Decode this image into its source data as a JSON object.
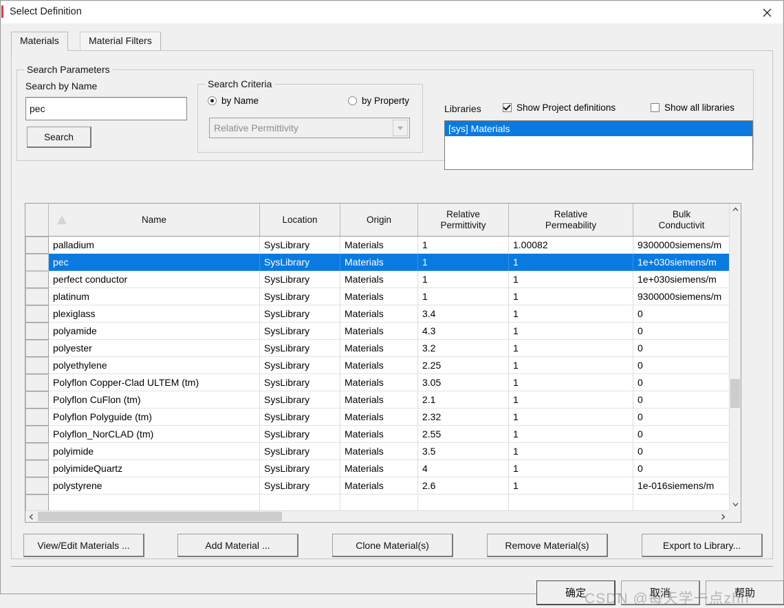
{
  "window": {
    "title": "Select Definition",
    "close_icon": "close-icon"
  },
  "tabs": [
    {
      "label": "Materials",
      "active": true
    },
    {
      "label": "Material Filters",
      "active": false
    }
  ],
  "search_parameters": {
    "group_title": "Search Parameters",
    "search_by_name_label": "Search by Name",
    "search_value": "pec",
    "search_placeholder": "",
    "search_button": "Search",
    "criteria": {
      "group_title": "Search Criteria",
      "by_name_label": "by Name",
      "by_property_label": "by Property",
      "selected": "by Name",
      "property_combo_value": "Relative Permittivity",
      "property_combo_enabled": false
    }
  },
  "libraries": {
    "label": "Libraries",
    "show_project_definitions_label": "Show Project definitions",
    "show_project_definitions_checked": true,
    "show_all_libraries_label": "Show all libraries",
    "show_all_libraries_checked": false,
    "items": [
      {
        "label": "[sys] Materials",
        "selected": true
      }
    ]
  },
  "grid": {
    "columns": [
      {
        "label": "",
        "key": "rowbtn"
      },
      {
        "label": "Name",
        "key": "name"
      },
      {
        "label": "Location",
        "key": "location"
      },
      {
        "label": "Origin",
        "key": "origin"
      },
      {
        "label": "Relative\nPermittivity",
        "key": "permittivity"
      },
      {
        "label": "Relative\nPermeability",
        "key": "permeability"
      },
      {
        "label": "Bulk\nConductivit",
        "key": "conductivity"
      }
    ],
    "column_labels": {
      "name": "Name",
      "location": "Location",
      "origin": "Origin",
      "permittivity_l1": "Relative",
      "permittivity_l2": "Permittivity",
      "permeability_l1": "Relative",
      "permeability_l2": "Permeability",
      "conductivity_l1": "Bulk",
      "conductivity_l2": "Conductivit"
    },
    "sort_indicator": "sort-ascending-icon",
    "selected_row_index": 1,
    "rows": [
      {
        "name": "palladium",
        "location": "SysLibrary",
        "origin": "Materials",
        "permittivity": "1",
        "permeability": "1.00082",
        "conductivity": "9300000siemens/m"
      },
      {
        "name": "pec",
        "location": "SysLibrary",
        "origin": "Materials",
        "permittivity": "1",
        "permeability": "1",
        "conductivity": "1e+030siemens/m"
      },
      {
        "name": "perfect conductor",
        "location": "SysLibrary",
        "origin": "Materials",
        "permittivity": "1",
        "permeability": "1",
        "conductivity": "1e+030siemens/m"
      },
      {
        "name": "platinum",
        "location": "SysLibrary",
        "origin": "Materials",
        "permittivity": "1",
        "permeability": "1",
        "conductivity": "9300000siemens/m"
      },
      {
        "name": "plexiglass",
        "location": "SysLibrary",
        "origin": "Materials",
        "permittivity": "3.4",
        "permeability": "1",
        "conductivity": "0"
      },
      {
        "name": "polyamide",
        "location": "SysLibrary",
        "origin": "Materials",
        "permittivity": "4.3",
        "permeability": "1",
        "conductivity": "0"
      },
      {
        "name": "polyester",
        "location": "SysLibrary",
        "origin": "Materials",
        "permittivity": "3.2",
        "permeability": "1",
        "conductivity": "0"
      },
      {
        "name": "polyethylene",
        "location": "SysLibrary",
        "origin": "Materials",
        "permittivity": "2.25",
        "permeability": "1",
        "conductivity": "0"
      },
      {
        "name": "Polyflon Copper-Clad ULTEM (tm)",
        "location": "SysLibrary",
        "origin": "Materials",
        "permittivity": "3.05",
        "permeability": "1",
        "conductivity": "0"
      },
      {
        "name": "Polyflon CuFlon (tm)",
        "location": "SysLibrary",
        "origin": "Materials",
        "permittivity": "2.1",
        "permeability": "1",
        "conductivity": "0"
      },
      {
        "name": "Polyflon Polyguide (tm)",
        "location": "SysLibrary",
        "origin": "Materials",
        "permittivity": "2.32",
        "permeability": "1",
        "conductivity": "0"
      },
      {
        "name": "Polyflon_NorCLAD (tm)",
        "location": "SysLibrary",
        "origin": "Materials",
        "permittivity": "2.55",
        "permeability": "1",
        "conductivity": "0"
      },
      {
        "name": "polyimide",
        "location": "SysLibrary",
        "origin": "Materials",
        "permittivity": "3.5",
        "permeability": "1",
        "conductivity": "0"
      },
      {
        "name": "polyimideQuartz",
        "location": "SysLibrary",
        "origin": "Materials",
        "permittivity": "4",
        "permeability": "1",
        "conductivity": "0"
      },
      {
        "name": "polystyrene",
        "location": "SysLibrary",
        "origin": "Materials",
        "permittivity": "2.6",
        "permeability": "1",
        "conductivity": "1e-016siemens/m"
      },
      {
        "name": "",
        "location": "",
        "origin": "",
        "permittivity": "",
        "permeability": "",
        "conductivity": ""
      }
    ],
    "scroll": {
      "up_arrow": "chevron-up-icon",
      "down_arrow": "chevron-down-icon",
      "left_arrow": "chevron-left-icon",
      "right_arrow": "chevron-right-icon"
    }
  },
  "actions": [
    {
      "label": "View/Edit Materials ..."
    },
    {
      "label": "Add Material ..."
    },
    {
      "label": "Clone Material(s)"
    },
    {
      "label": "Remove Material(s)"
    },
    {
      "label": "Export to Library..."
    }
  ],
  "footer": {
    "ok_label": "确定",
    "cancel_label": "取消",
    "help_label": "帮助",
    "watermark": "CSDN @每天学一点zhn"
  },
  "colors": {
    "selection_blue": "#0a7ae0",
    "dialog_face": "#f0f0f0",
    "border_gray": "#9b9b9b"
  }
}
